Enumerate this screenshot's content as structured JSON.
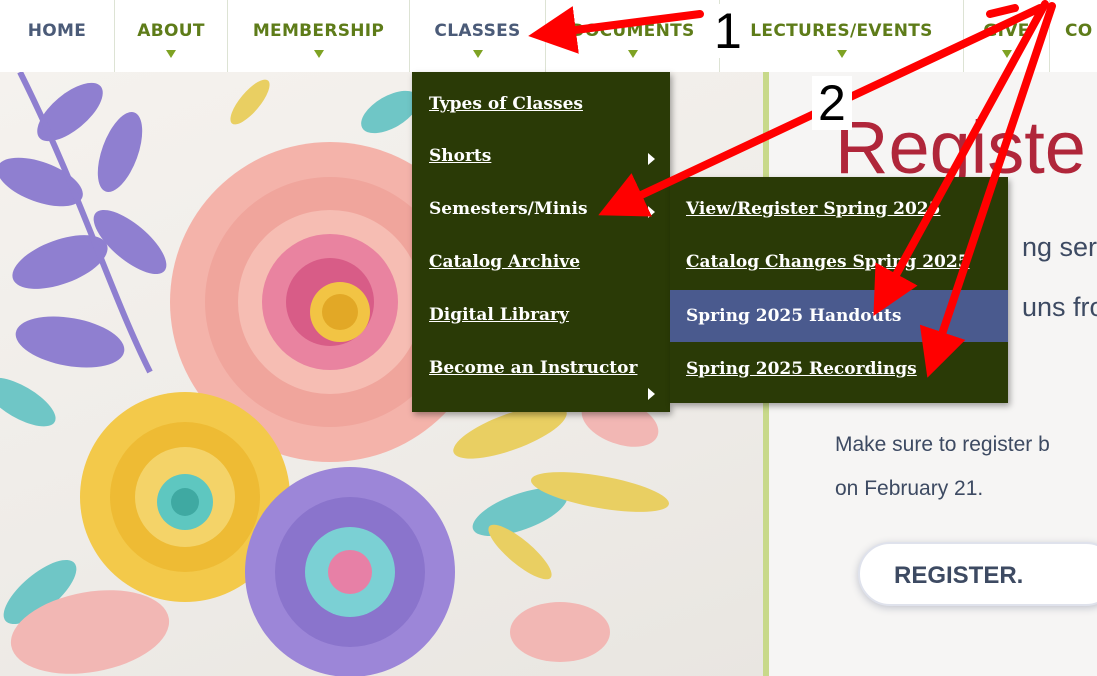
{
  "nav": {
    "items": [
      {
        "label": "HOME",
        "caret": false
      },
      {
        "label": "ABOUT",
        "caret": true
      },
      {
        "label": "MEMBERSHIP",
        "caret": true
      },
      {
        "label": "CLASSES",
        "caret": true
      },
      {
        "label": "DOCUMENTS",
        "caret": true
      },
      {
        "label": "LECTURES/EVENTS",
        "caret": true
      },
      {
        "label": "GIVE",
        "caret": true
      },
      {
        "label": "CO",
        "caret": false
      }
    ],
    "text_color": "#4b5b78",
    "green_color": "#5e7c19"
  },
  "classes_menu": {
    "items": [
      {
        "label": "Types of Classes",
        "has_submenu": false
      },
      {
        "label": "Shorts",
        "has_submenu": true
      },
      {
        "label": "Semesters/Minis",
        "has_submenu": true
      },
      {
        "label": "Catalog Archive",
        "has_submenu": false
      },
      {
        "label": "Digital Library",
        "has_submenu": false
      },
      {
        "label": "Become an Instructor",
        "has_submenu": true
      }
    ],
    "background": "#2a3a06"
  },
  "semesters_submenu": {
    "items": [
      {
        "label": "View/Register Spring 2025",
        "active": false
      },
      {
        "label": "Catalog Changes Spring 2025",
        "active": false
      },
      {
        "label": "Spring 2025 Handouts",
        "active": true
      },
      {
        "label": "Spring 2025 Recordings",
        "active": false
      }
    ],
    "highlight_color": "#4a5a8e"
  },
  "register_panel": {
    "heading": "Registe",
    "line1": "ng ser",
    "line2": "uns fro",
    "text_line1": "Make sure to register b",
    "text_line2": "on February 21.",
    "button_label": "REGISTER.",
    "heading_color": "#b0263a"
  },
  "annotations": {
    "step1": "1",
    "step2": "2",
    "arrow_color": "#ff0000"
  }
}
